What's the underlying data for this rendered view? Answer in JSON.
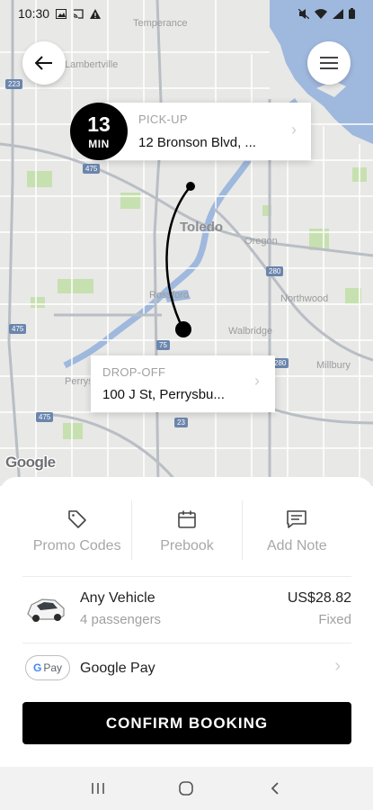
{
  "status_bar": {
    "time": "10:30"
  },
  "map": {
    "city_labels": [
      "Temperance",
      "Lambertville",
      "Toledo",
      "Oregon",
      "Northwood",
      "Rossford",
      "Walbridge",
      "Millbury",
      "Perrysburg"
    ],
    "highway_shields": [
      "223",
      "475",
      "280",
      "475",
      "75",
      "280",
      "475",
      "23"
    ],
    "attribution": "Google"
  },
  "pickup": {
    "eta_value": "13",
    "eta_unit": "MIN",
    "kicker": "PICK-UP",
    "address": "12 Bronson Blvd, ..."
  },
  "dropoff": {
    "kicker": "DROP-OFF",
    "address": "100 J St, Perrysbu..."
  },
  "actions": [
    {
      "label": "Promo Codes",
      "icon": "tag-icon"
    },
    {
      "label": "Prebook",
      "icon": "calendar-icon"
    },
    {
      "label": "Add Note",
      "icon": "note-icon"
    }
  ],
  "vehicle": {
    "name": "Any Vehicle",
    "passengers": "4 passengers",
    "price": "US$28.82",
    "price_type": "Fixed"
  },
  "payment": {
    "badge_g": "G",
    "badge_text": "Pay",
    "method": "Google Pay"
  },
  "confirm_label": "CONFIRM BOOKING"
}
